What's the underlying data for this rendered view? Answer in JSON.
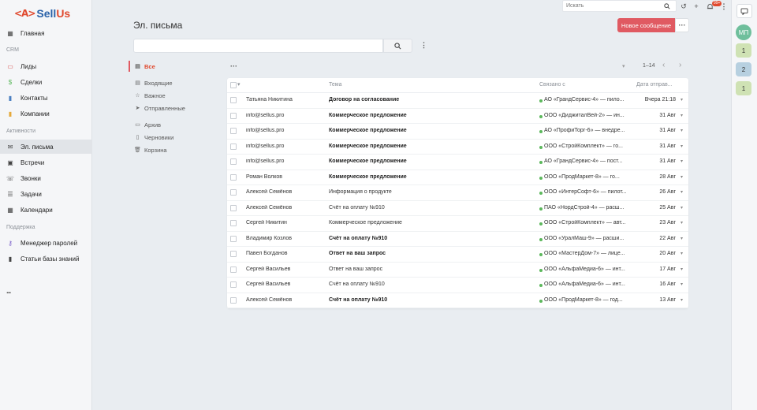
{
  "logo": {
    "mark": "<A>",
    "brand_a": "Sell",
    "brand_b": "Us"
  },
  "sidebar": {
    "items": [
      {
        "label": "Главная",
        "icon": "grid-icon"
      },
      {
        "section": "CRM"
      },
      {
        "label": "Лиды",
        "icon": "id-card-icon"
      },
      {
        "label": "Сделки",
        "icon": "dollar-icon"
      },
      {
        "label": "Контакты",
        "icon": "contacts-icon"
      },
      {
        "label": "Компании",
        "icon": "building-icon"
      },
      {
        "section": "Активности"
      },
      {
        "label": "Эл. письма",
        "icon": "envelope-icon",
        "active": true
      },
      {
        "label": "Встречи",
        "icon": "calendar-icon"
      },
      {
        "label": "Звонки",
        "icon": "phone-icon"
      },
      {
        "label": "Задачи",
        "icon": "tasks-icon"
      },
      {
        "label": "Календари",
        "icon": "calendar-grid-icon"
      },
      {
        "section": "Поддержка"
      },
      {
        "label": "Менеджер паролей",
        "icon": "key-icon"
      },
      {
        "label": "Статьи базы знаний",
        "icon": "book-icon"
      }
    ],
    "more": "..."
  },
  "topbar": {
    "search_placeholder": "Искать",
    "notif_count": "99+"
  },
  "rail": {
    "avatar": "МП",
    "badges": [
      "1",
      "2",
      "1"
    ]
  },
  "main": {
    "title": "Эл. письма",
    "new_button": "Новое сообщение",
    "new_more": "···",
    "list_tools": "···",
    "pager": "1–14",
    "folders": [
      {
        "label": "Все",
        "active": true,
        "icon": "inbox-icon"
      },
      {
        "label": "Входящие",
        "icon": "inbox-icon"
      },
      {
        "label": "Важное",
        "icon": "star-icon"
      },
      {
        "label": "Отправленные",
        "icon": "send-icon"
      },
      {
        "label": "Архив",
        "icon": "archive-icon"
      },
      {
        "label": "Черновики",
        "icon": "draft-icon"
      },
      {
        "label": "Корзина",
        "icon": "trash-icon"
      }
    ],
    "columns": {
      "subject": "Тема",
      "related": "Связано с",
      "date": "Дата отправ..."
    },
    "rows": [
      {
        "from": "Татьяна Никитина",
        "subject": "Договор на согласование",
        "bold": true,
        "related": "АО «ГрандСервис-4» — пило...",
        "date": "Вчера 21:18"
      },
      {
        "from": "info@sellus.pro",
        "subject": "Коммерческое предложение",
        "bold": true,
        "related": "ООО «ДиджиталВей-2» — ин...",
        "date": "31 Авг"
      },
      {
        "from": "info@sellus.pro",
        "subject": "Коммерческое предложение",
        "bold": true,
        "related": "АО «ПрофиТорг-6» — внедре...",
        "date": "31 Авг"
      },
      {
        "from": "info@sellus.pro",
        "subject": "Коммерческое предложение",
        "bold": true,
        "related": "ООО «СтройКомплект» — го...",
        "date": "31 Авг"
      },
      {
        "from": "info@sellus.pro",
        "subject": "Коммерческое предложение",
        "bold": true,
        "related": "АО «ГрандСервис-4» — пост...",
        "date": "31 Авг"
      },
      {
        "from": "Роман Волков",
        "subject": "Коммерческое предложение",
        "bold": true,
        "related": "ООО «ПродМаркет-8» — го...",
        "date": "28 Авг"
      },
      {
        "from": "Алексей Семёнов",
        "subject": "Информация о продукте",
        "bold": false,
        "related": "ООО «ИнтерСофт-6» — пилот...",
        "date": "26 Авг"
      },
      {
        "from": "Алексей Семёнов",
        "subject": "Счёт на оплату №910",
        "bold": false,
        "related": "ПАО «НордСтрой-4» — расш...",
        "date": "25 Авг"
      },
      {
        "from": "Сергей Никитин",
        "subject": "Коммерческое предложение",
        "bold": false,
        "related": "ООО «СтройКомплект» — авт...",
        "date": "23 Авг"
      },
      {
        "from": "Владимир Козлов",
        "subject": "Счёт на оплату №910",
        "bold": true,
        "related": "ООО «УралМаш-9» — расши...",
        "date": "22 Авг"
      },
      {
        "from": "Павел Богданов",
        "subject": "Ответ на ваш запрос",
        "bold": true,
        "related": "ООО «МастерДом-7» — лице...",
        "date": "20 Авг"
      },
      {
        "from": "Сергей Васильев",
        "subject": "Ответ на ваш запрос",
        "bold": false,
        "related": "ООО «АльфаМедиа-6» — инт...",
        "date": "17 Авг"
      },
      {
        "from": "Сергей Васильев",
        "subject": "Счёт на оплату №910",
        "bold": false,
        "related": "ООО «АльфаМедиа-6» — инт...",
        "date": "16 Авг"
      },
      {
        "from": "Алексей Семёнов",
        "subject": "Счёт на оплату №910",
        "bold": true,
        "related": "ООО «ПродМаркет-8» — год...",
        "date": "13 Авг"
      }
    ]
  }
}
